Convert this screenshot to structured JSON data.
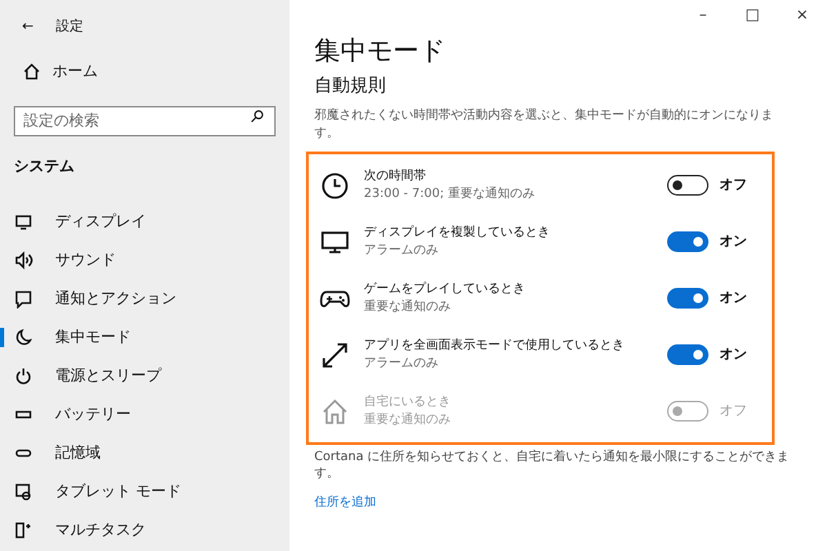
{
  "window": {
    "title": "設定",
    "back": "←",
    "controls": [
      "–",
      "□",
      "×"
    ]
  },
  "sidebar": {
    "home": "ホーム",
    "search": {
      "placeholder": "設定の検索"
    },
    "section": "システム",
    "items": [
      {
        "kind": "display",
        "label": "ディスプレイ",
        "selected": false
      },
      {
        "kind": "sound",
        "label": "サウンド",
        "selected": false
      },
      {
        "kind": "notify",
        "label": "通知とアクション",
        "selected": false
      },
      {
        "kind": "moon",
        "label": "集中モード",
        "selected": true
      },
      {
        "kind": "power",
        "label": "電源とスリープ",
        "selected": false
      },
      {
        "kind": "battery",
        "label": "バッテリー",
        "selected": false
      },
      {
        "kind": "storage",
        "label": "記憶域",
        "selected": false
      },
      {
        "kind": "tablet",
        "label": "タブレット モード",
        "selected": false
      },
      {
        "kind": "multitask",
        "label": "マルチタスク",
        "selected": false
      }
    ]
  },
  "page": {
    "title": "集中モード",
    "heading": "自動規則",
    "description": "邪魔されたくない時間帯や活動内容を選ぶと、集中モードが自動的にオンになります。",
    "rules": [
      {
        "kind": "clock",
        "title": "次の時間帯",
        "subtitle": "23:00 - 7:00; 重要な通知のみ",
        "on": false,
        "disabled": false,
        "state": "オフ"
      },
      {
        "kind": "monitor",
        "title": "ディスプレイを複製しているとき",
        "subtitle": "アラームのみ",
        "on": true,
        "disabled": false,
        "state": "オン"
      },
      {
        "kind": "gamepad",
        "title": "ゲームをプレイしているとき",
        "subtitle": "重要な通知のみ",
        "on": true,
        "disabled": false,
        "state": "オン"
      },
      {
        "kind": "fullscreen",
        "title": "アプリを全画面表示モードで使用しているとき",
        "subtitle": "アラームのみ",
        "on": true,
        "disabled": false,
        "state": "オン"
      },
      {
        "kind": "home",
        "title": "自宅にいるとき",
        "subtitle": "重要な通知のみ",
        "on": false,
        "disabled": true,
        "state": "オフ"
      }
    ],
    "note": "Cortana に住所を知らせておくと、自宅に着いたら通知を最小限にすることができます。",
    "link": "住所を追加"
  }
}
